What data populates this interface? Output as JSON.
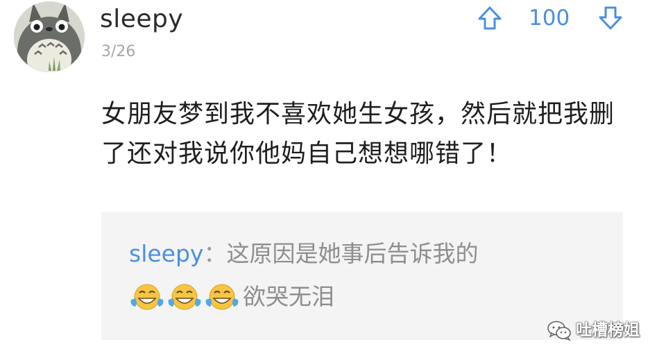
{
  "comment": {
    "username": "sleepy",
    "date": "3/26",
    "vote_count": "100",
    "body": "女朋友梦到我不喜欢她生女孩，然后就把我删了还对我说你他妈自己想想哪错了！"
  },
  "reply": {
    "author": "sleepy",
    "colon": "：",
    "text": "这原因是她事后告诉我的",
    "emojis": [
      "tears-of-joy-emoji",
      "tears-of-joy-emoji",
      "tears-of-joy-emoji"
    ],
    "text2": "欲哭无泪"
  },
  "watermark": {
    "text": "吐槽榜姐",
    "icon": "wechat-icon"
  },
  "colors": {
    "accent": "#4a8fe0",
    "text": "#1e1e1e",
    "muted": "#a6a6a6",
    "quote_bg": "#f4f4f4"
  }
}
